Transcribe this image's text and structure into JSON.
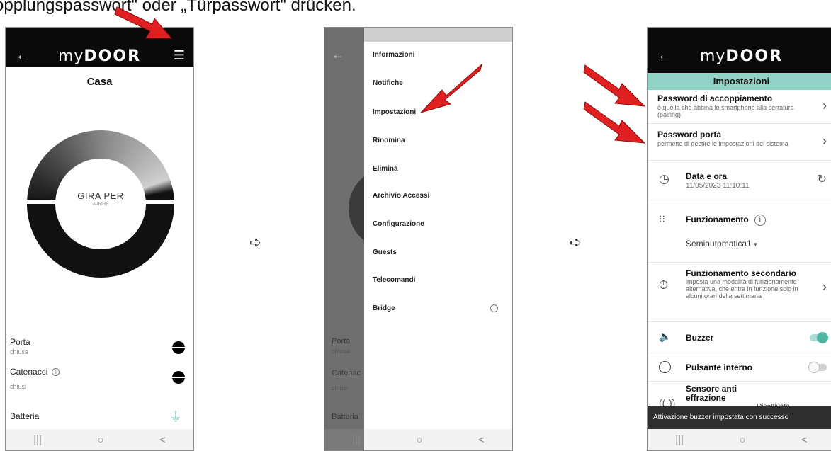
{
  "caption": "opplungspasswort\" oder „Türpasswort\" drücken.",
  "app": {
    "logo_light": "my",
    "logo_bold": "DOOR",
    "back_icon": "arrow-left-icon",
    "menu_icon": "hamburger-menu-icon"
  },
  "navbar": {
    "recent": "|||",
    "home": "○",
    "back": "<"
  },
  "phone1": {
    "title": "Casa",
    "dial_main": "GIRA PER",
    "dial_sub": "APRIRE",
    "porta_label": "Porta",
    "porta_state": "chiusa",
    "catenacci_label": "Catenacci",
    "catenacci_state": "chiusi",
    "batteria_label": "Batteria"
  },
  "phone2": {
    "menu": [
      "Informazioni",
      "Notifiche",
      "Impostazioni",
      "Rinomina",
      "Elimina",
      "Archivio Accessi",
      "Configurazione",
      "Guests",
      "Telecomandi",
      "Bridge"
    ],
    "behind_labels": {
      "porta": "Porta",
      "porta_state": "chiusa",
      "catenacci": "Catenac",
      "catenacci_state": "chiusi",
      "batteria": "Batteria"
    }
  },
  "phone3": {
    "section_title": "Impostazioni",
    "pairing_title": "Password di accoppiamento",
    "pairing_desc": "è quella che abbina lo smartphone alla serratura (pairing)",
    "door_pw_title": "Password porta",
    "door_pw_desc": "permette di gestire le impostazioni del sistema",
    "date_title": "Data e ora",
    "date_value": "11/05/2023 11:10:11",
    "mode_title": "Funzionamento",
    "mode_value": "Semiautomatica1",
    "secondary_title": "Funzionamento secondario",
    "secondary_desc": "imposta una modalità di funzionamento alternativa, che entra in funzione solo in alcuni orari della settimana",
    "buzzer_label": "Buzzer",
    "buzzer_on": true,
    "button_label": "Pulsante interno",
    "button_on": false,
    "sensor_label": "Sensore anti effrazione",
    "sensor_value": "Disattivato",
    "snackbar": "Attivazione buzzer impostata con successo"
  },
  "colors": {
    "accent": "#92d2c6",
    "toggle_on": "#4db7a3",
    "arrow": "#e02020",
    "appbar": "#0a0a0a"
  }
}
